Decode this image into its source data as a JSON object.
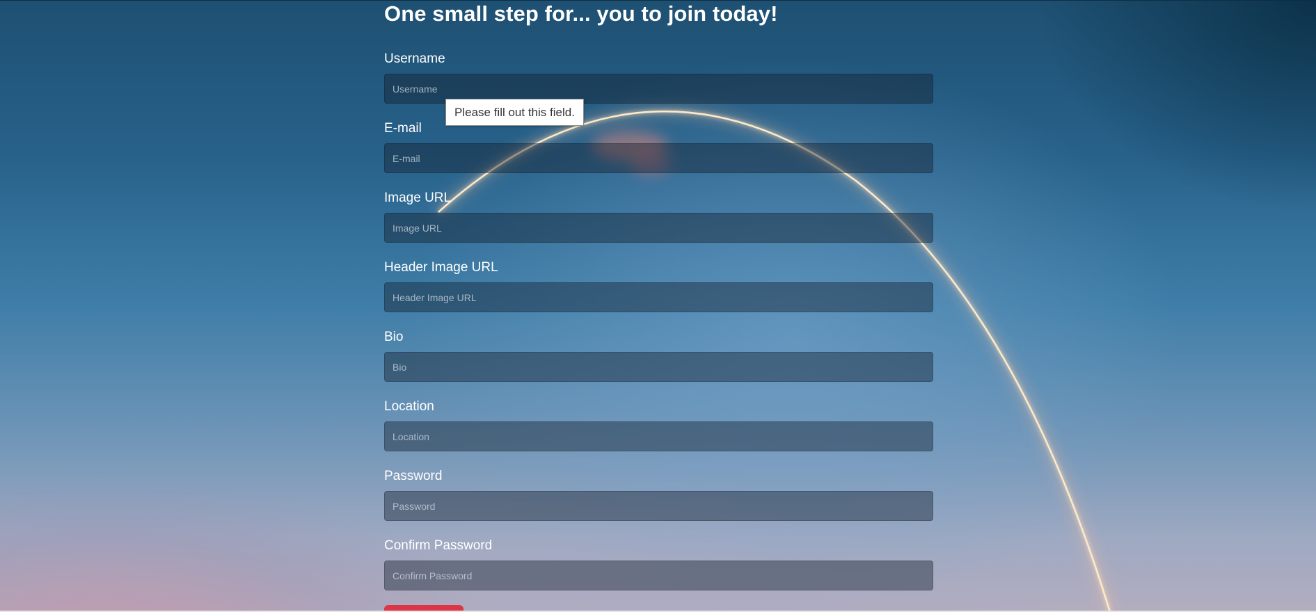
{
  "page": {
    "title": "One small step for... you to join today!"
  },
  "fields": [
    {
      "label": "Username",
      "placeholder": "Username",
      "value": ""
    },
    {
      "label": "E-mail",
      "placeholder": "E-mail",
      "value": ""
    },
    {
      "label": "Image URL",
      "placeholder": "Image URL",
      "value": ""
    },
    {
      "label": "Header Image URL",
      "placeholder": "Header Image URL",
      "value": ""
    },
    {
      "label": "Bio",
      "placeholder": "Bio",
      "value": ""
    },
    {
      "label": "Location",
      "placeholder": "Location",
      "value": ""
    },
    {
      "label": "Password",
      "placeholder": "Password",
      "value": ""
    },
    {
      "label": "Confirm Password",
      "placeholder": "Confirm Password",
      "value": ""
    }
  ],
  "validation": {
    "tooltip": "Please fill out this field."
  },
  "submit": {
    "label": ""
  },
  "colors": {
    "submit_button": "#dc3545",
    "heading_text": "#ffffff",
    "tooltip_background": "#ffffff"
  },
  "icons": {
    "background": "rocket-launch-trail-photo"
  }
}
